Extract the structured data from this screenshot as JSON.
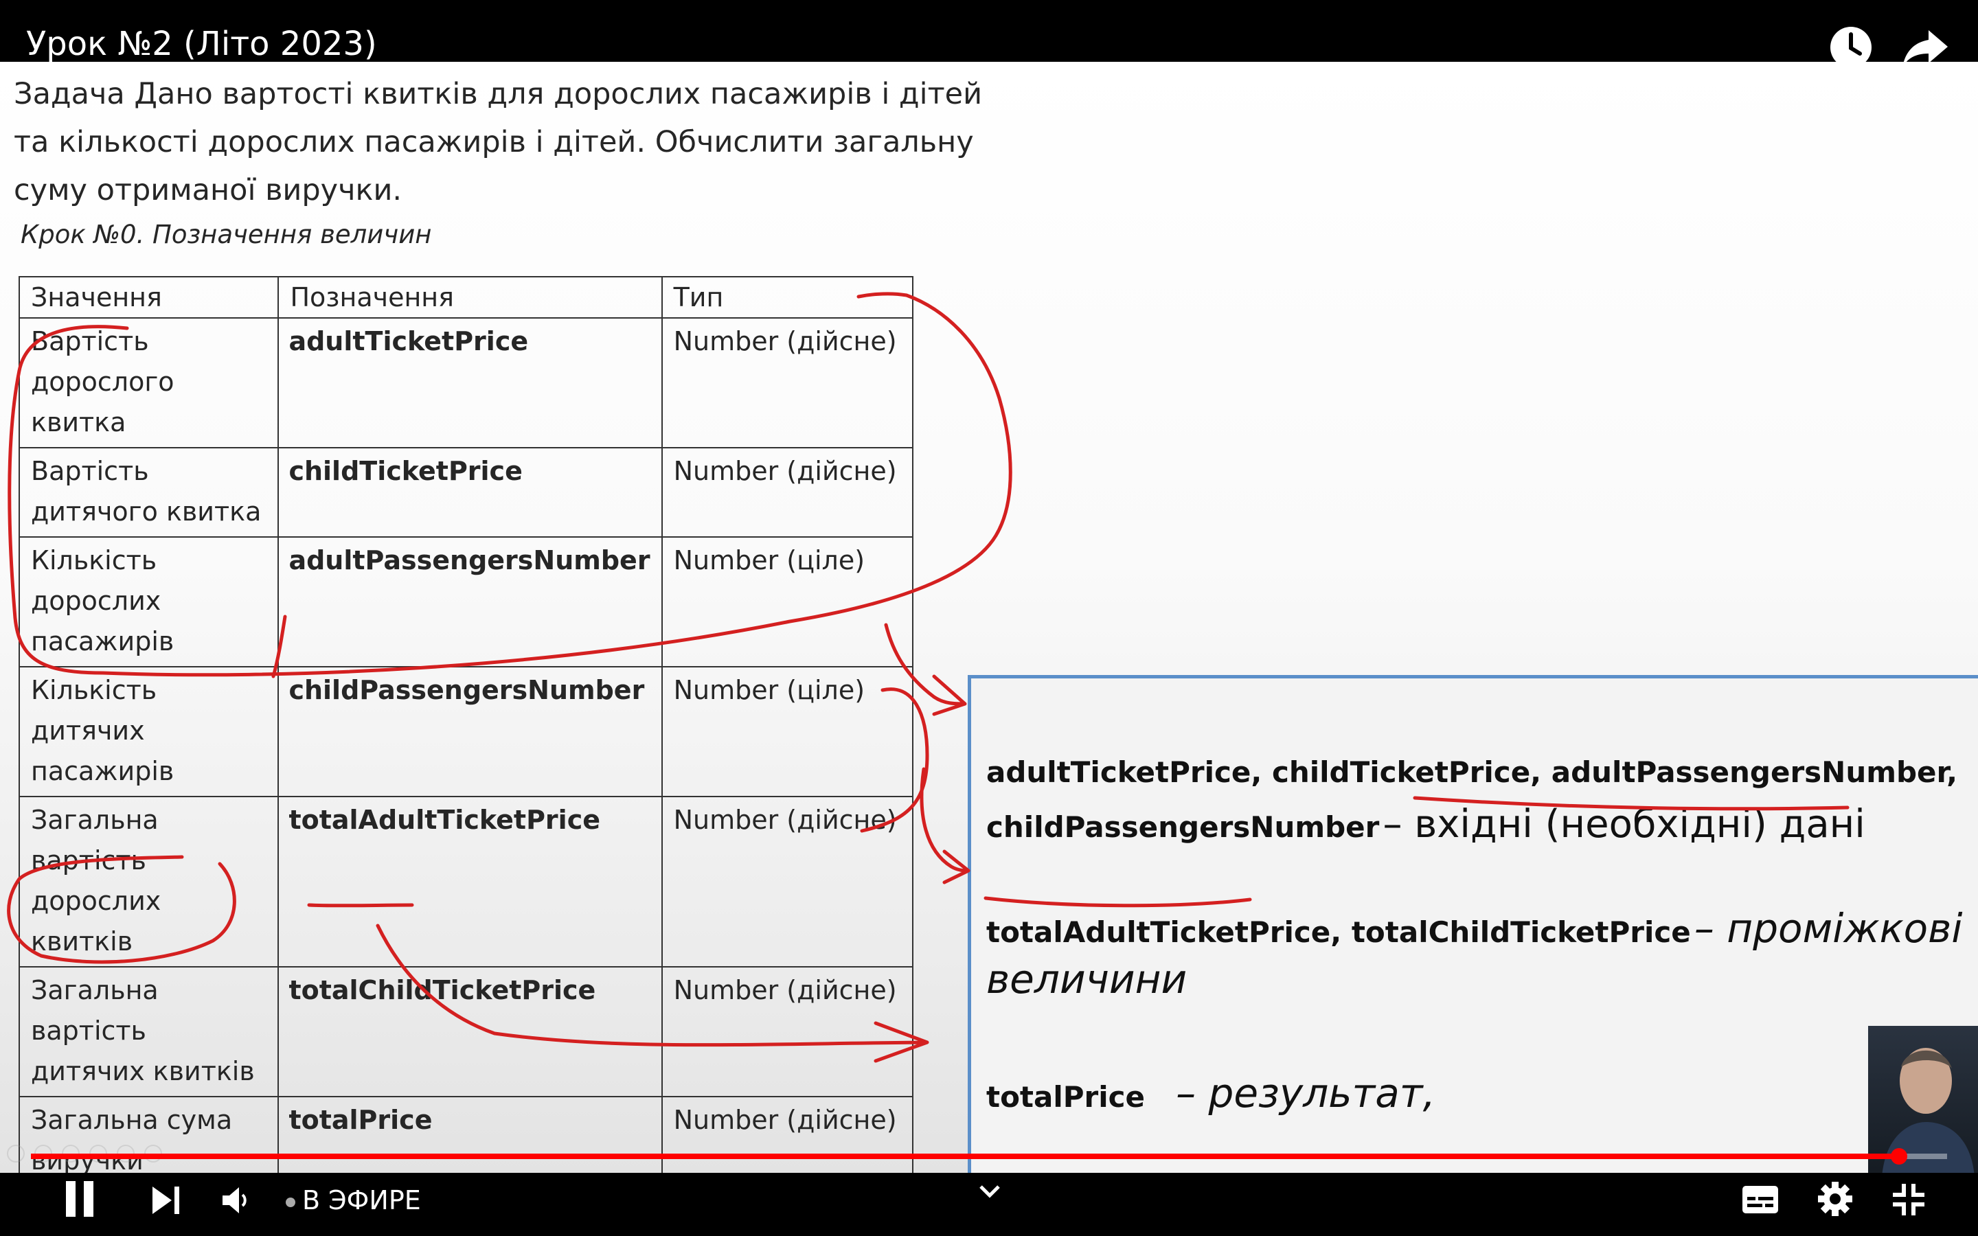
{
  "player": {
    "title": "Урок №2 (Літо 2023)",
    "live_label": "В ЭФИРЕ",
    "progress_fraction": 0.975,
    "accent_color": "#ff0000",
    "icons": {
      "watch_later": "clock-icon",
      "share": "share-icon",
      "pause": "pause-icon",
      "next": "next-icon",
      "volume": "volume-icon",
      "chevron": "chevron-down-icon",
      "subtitles": "subtitles-icon",
      "settings": "gear-icon",
      "exit_fullscreen": "exit-fullscreen-icon"
    }
  },
  "slide": {
    "task_text": "Задача Дано вартості квитків для дорослих пасажирів і дітей та кількості дорослих пасажирів і дітей. Обчислити загальну суму отриманої виручки.",
    "step_heading": "Крок №0. Позначення величин",
    "table": {
      "headers": [
        "Значення",
        "Позначення",
        "Тип"
      ],
      "rows": [
        [
          "Вартість дорослого квитка",
          "adultTicketPrice",
          "Number (дійсне)"
        ],
        [
          "Вартість дитячого квитка",
          "childTicketPrice",
          "Number (дійсне)"
        ],
        [
          "Кількість дорослих пасажирів",
          "adultPassengersNumber",
          "Number (ціле)"
        ],
        [
          "Кількість дитячих пасажирів",
          "childPassengersNumber",
          "Number (ціле)"
        ],
        [
          "Загальна вартість дорослих квитків",
          "totalAdultTicketPrice",
          "Number (дійсне)"
        ],
        [
          "Загальна вартість дитячих квитків",
          "totalChildTicketPrice",
          "Number (дійсне)"
        ],
        [
          "Загальна сума виручки",
          "totalPrice",
          "Number (дійсне)"
        ]
      ]
    },
    "panel": {
      "line1_vars": "adultTicketPrice, childTicketPrice, adultPassengersNumber,",
      "line2_var": "childPassengersNumber",
      "line2_text": "– вхідні (необхідні) дані",
      "line3_vars": "totalAdultTicketPrice, totalChildTicketPrice",
      "line3_text": "– проміжкові",
      "line4_text": "величини",
      "line5_var": "totalPrice",
      "line5_text": "– результат,"
    },
    "annotation_color": "#d42020"
  }
}
